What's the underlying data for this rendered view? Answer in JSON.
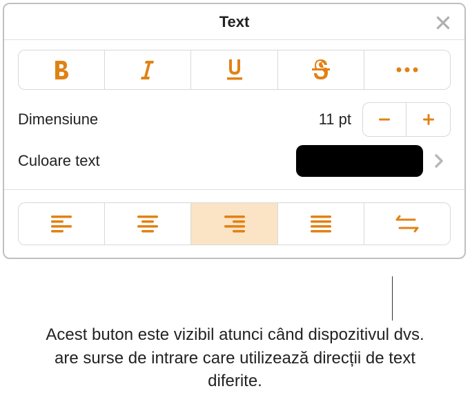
{
  "header": {
    "title": "Text"
  },
  "size": {
    "label": "Dimensiune",
    "value": "11 pt"
  },
  "color": {
    "label": "Culoare text",
    "swatch": "#000000"
  },
  "callout": {
    "text": "Acest buton este vizibil atunci când dispozitivul dvs. are surse de intrare care utilizează direcții de text diferite."
  }
}
